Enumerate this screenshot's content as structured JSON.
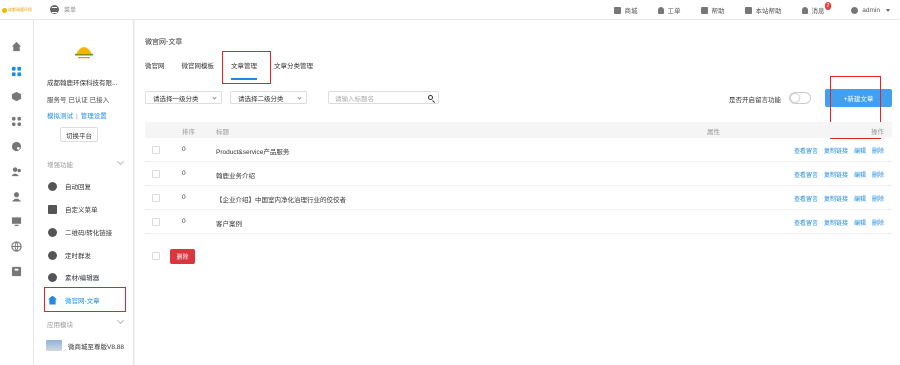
{
  "topbar": {
    "brand_text": "成都瑞鹿环保",
    "menu_label": "菜单",
    "nav": [
      {
        "icon": "store-icon",
        "label": "商城"
      },
      {
        "icon": "bell-icon",
        "label": "工单"
      },
      {
        "icon": "help-icon",
        "label": "帮助"
      },
      {
        "icon": "site-help-icon",
        "label": "本站帮助"
      },
      {
        "icon": "bell-icon",
        "label": "消息",
        "badge": "2"
      },
      {
        "icon": "user-icon",
        "label": "admin"
      }
    ]
  },
  "sidebar": {
    "company": "成都翰鹿环保科技有限...",
    "service_line": "服务号  已认证  已接入",
    "links": {
      "simulate": "模拟测试",
      "separator": "|",
      "manage": "管理设置"
    },
    "switch_label": "切换平台",
    "section_enhance": "增强功能",
    "items": [
      {
        "label": "自动回复",
        "icon": "chat-icon"
      },
      {
        "label": "自定义菜单",
        "icon": "menu-icon"
      },
      {
        "label": "二维码/转化链接",
        "icon": "qrcode-icon"
      },
      {
        "label": "定时群发",
        "icon": "clock-icon"
      },
      {
        "label": "素材/编辑器",
        "icon": "edit-icon"
      },
      {
        "label": "微官网-文章",
        "icon": "home-icon"
      }
    ],
    "section_apps": "应用模块",
    "app_item": "微商城至尊版V8.88"
  },
  "main": {
    "title": "微官网-文章",
    "tabs": [
      "微官网",
      "微官网模板",
      "文章管理",
      "文章分类管理"
    ],
    "active_tab": 2,
    "filters": {
      "level1": "请选择一级分类",
      "level2": "请选择二级分类",
      "search_placeholder": "请输入标题名"
    },
    "toggle_label": "是否开启留言功能",
    "new_button": "+新建文章",
    "columns": {
      "order": "排序",
      "title": "标题",
      "attr": "属性",
      "ops": "操作"
    },
    "rows": [
      {
        "order": "0",
        "title": "Product&service产品服务"
      },
      {
        "order": "0",
        "title": "翰鹿业务介绍"
      },
      {
        "order": "0",
        "title": "【企业介绍】中国室内净化治理行业的佼佼者"
      },
      {
        "order": "0",
        "title": "客户案例"
      }
    ],
    "row_actions": [
      "查看留言",
      "复制链接",
      "编辑",
      "删除"
    ],
    "delete_button": "删除"
  },
  "colors": {
    "accent": "#1f8ae0",
    "primary_button": "#42a1ee",
    "danger": "#d9363d",
    "highlight": "#e22424"
  }
}
